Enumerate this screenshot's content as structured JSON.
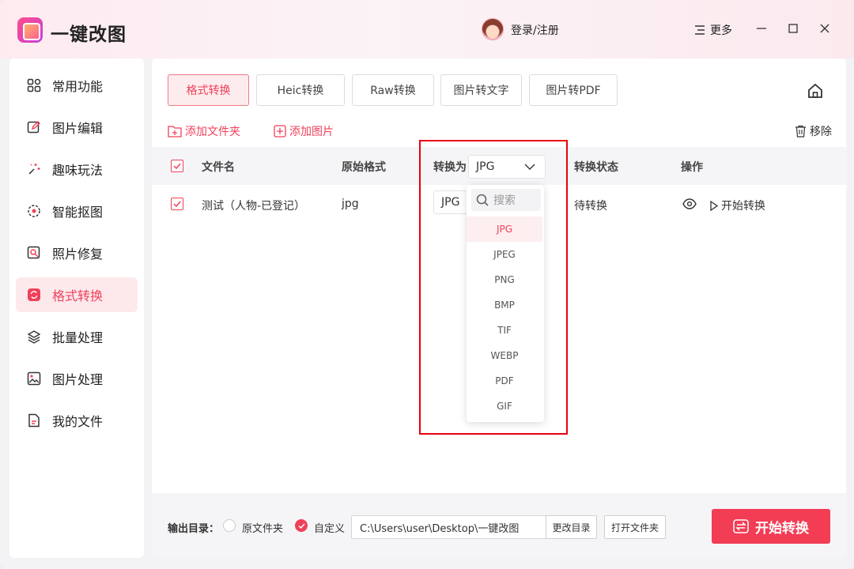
{
  "app": {
    "title": "一键改图",
    "login": "登录/注册",
    "more": "更多"
  },
  "sidebar": {
    "items": [
      {
        "label": "常用功能",
        "icon": "grid-icon"
      },
      {
        "label": "图片编辑",
        "icon": "edit-icon"
      },
      {
        "label": "趣味玩法",
        "icon": "sparkle-icon"
      },
      {
        "label": "智能抠图",
        "icon": "cutout-icon"
      },
      {
        "label": "照片修复",
        "icon": "repair-icon"
      },
      {
        "label": "格式转换",
        "icon": "convert-icon"
      },
      {
        "label": "批量处理",
        "icon": "layers-icon"
      },
      {
        "label": "图片处理",
        "icon": "image-icon"
      },
      {
        "label": "我的文件",
        "icon": "file-icon"
      }
    ],
    "active_index": 5
  },
  "tabs": [
    {
      "label": "格式转换"
    },
    {
      "label": "Heic转换"
    },
    {
      "label": "Raw转换"
    },
    {
      "label": "图片转文字"
    },
    {
      "label": "图片转PDF"
    }
  ],
  "actions": {
    "add_folder": "添加文件夹",
    "add_image": "添加图片",
    "remove": "移除"
  },
  "table": {
    "headers": {
      "name": "文件名",
      "orig_format": "原始格式",
      "convert_to": "转换为",
      "status": "转换状态",
      "ops": "操作"
    },
    "header_select_value": "JPG",
    "rows": [
      {
        "name": "测试（人物-已登记）",
        "orig_format": "jpg",
        "target": "JPG",
        "status": "待转换",
        "op_start": "开始转换"
      }
    ]
  },
  "dropdown": {
    "search_placeholder": "搜索",
    "options": [
      "JPG",
      "JPEG",
      "PNG",
      "BMP",
      "TIF",
      "WEBP",
      "PDF",
      "GIF"
    ],
    "selected": "JPG"
  },
  "bottom": {
    "output_label": "输出目录：",
    "radio_original": "原文件夹",
    "radio_custom": "自定义",
    "path": "C:\\Users\\user\\Desktop\\一键改图",
    "change_dir": "更改目录",
    "open_folder": "打开文件夹",
    "start": "开始转换"
  },
  "colors": {
    "accent": "#f0405a",
    "highlight_box": "#e8000f"
  }
}
